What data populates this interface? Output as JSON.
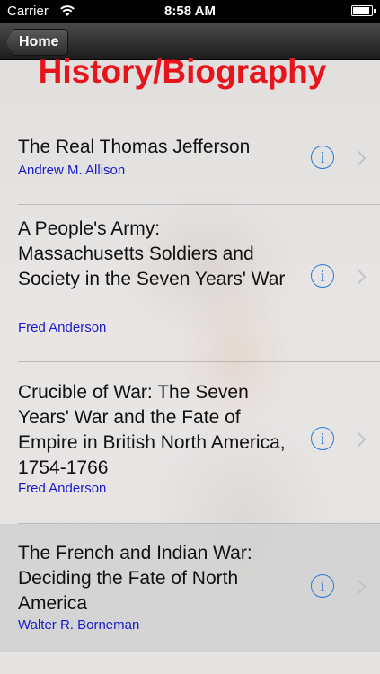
{
  "status_bar": {
    "carrier": "Carrier",
    "time": "8:58 AM",
    "battery_level": 0.95
  },
  "nav": {
    "back_label": "Home"
  },
  "page": {
    "title": "History/Biography"
  },
  "books": [
    {
      "title": "The Real Thomas Jefferson",
      "author": "Andrew M. Allison"
    },
    {
      "title": "A People's Army: Massachusetts Soldiers and Society in the Seven Years' War",
      "author": "Fred Anderson"
    },
    {
      "title": "Crucible of War: The Seven Years' War and the Fate of Empire in British North America, 1754-1766",
      "author": "Fred Anderson"
    },
    {
      "title": "The French and Indian War: Deciding the Fate of North America",
      "author": "Walter R. Borneman"
    }
  ],
  "selected_index": 3,
  "colors": {
    "title_red": "#e8141c",
    "author_blue": "#1a1acc",
    "info_blue": "#2a79d6"
  },
  "icons": {
    "info": "info-circle-icon",
    "disclosure": "chevron-right-icon",
    "wifi": "wifi-icon",
    "battery": "battery-icon"
  }
}
